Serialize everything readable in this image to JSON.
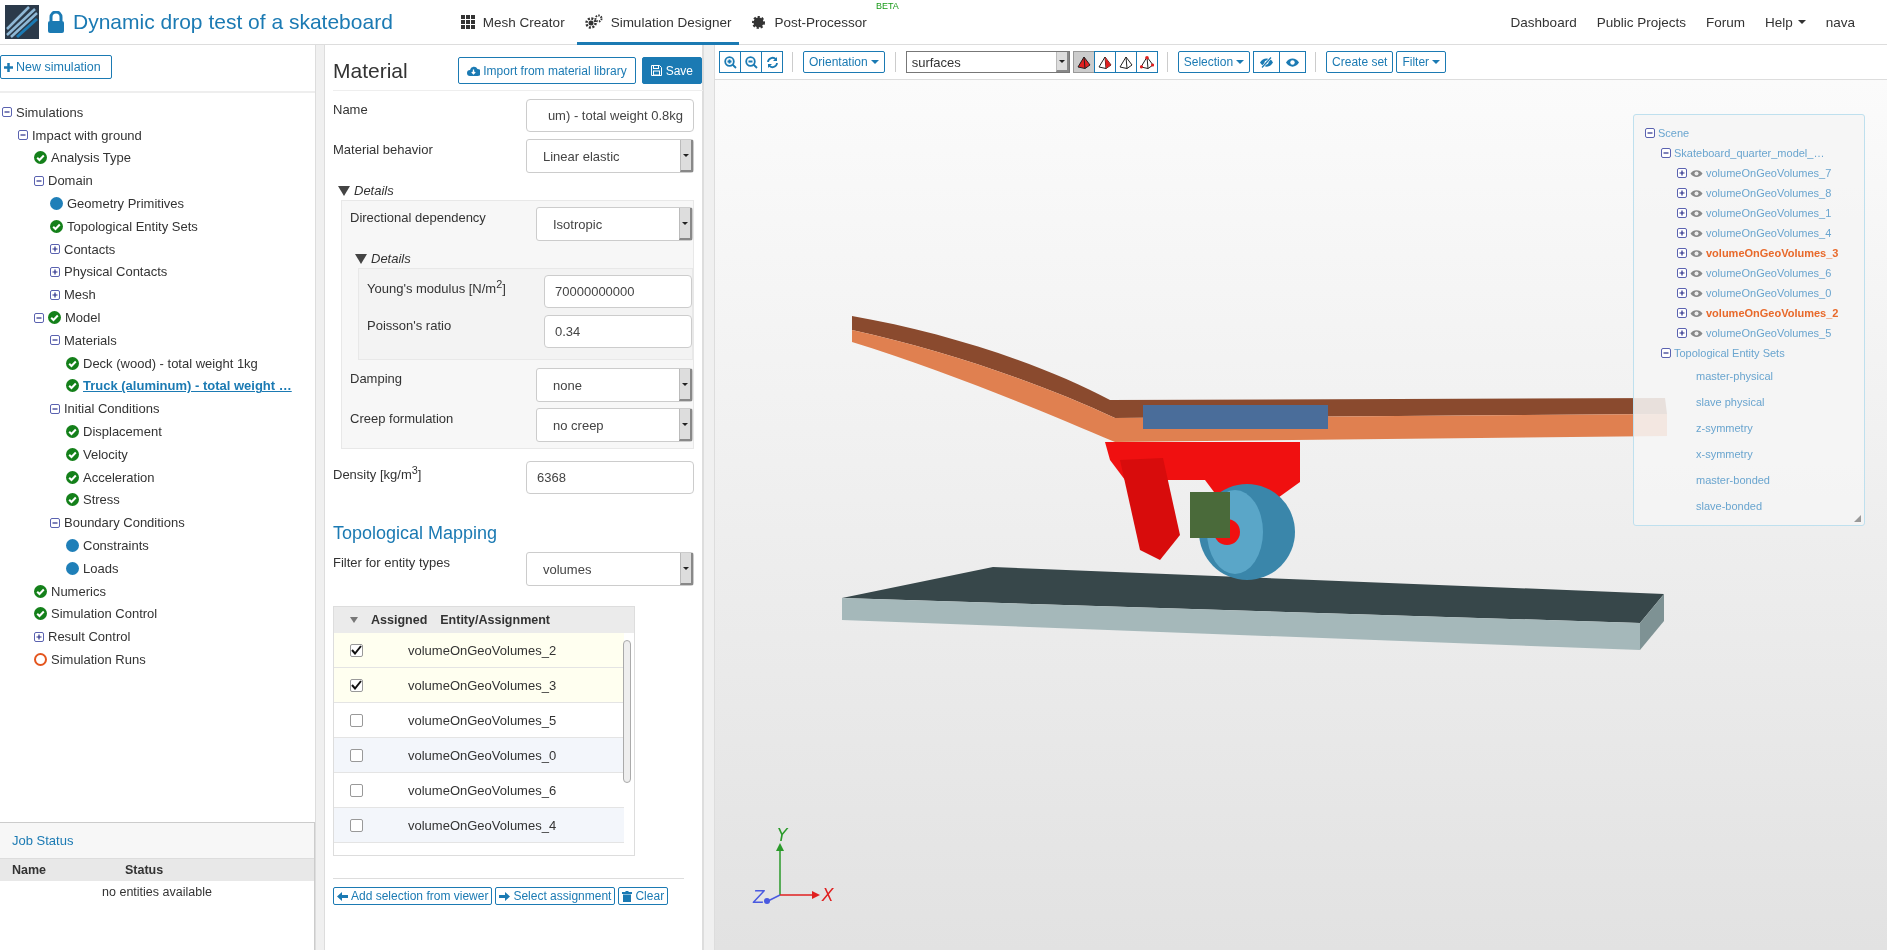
{
  "header": {
    "title": "Dynamic drop test of a skateboard",
    "tabs": [
      {
        "label": "Mesh Creator",
        "kind": "grid",
        "selected": false
      },
      {
        "label": "Simulation Designer",
        "kind": "gears",
        "selected": true
      },
      {
        "label": "Post-Processor",
        "kind": "cog",
        "selected": false,
        "badge": "BETA"
      }
    ],
    "links": [
      {
        "label": "Dashboard",
        "dropdown": false
      },
      {
        "label": "Public Projects",
        "dropdown": false
      },
      {
        "label": "Forum",
        "dropdown": false
      },
      {
        "label": "Help",
        "dropdown": true
      },
      {
        "label": "nava",
        "dropdown": false
      }
    ]
  },
  "sidebar": {
    "new_button": "New simulation",
    "tree": [
      {
        "label": "Simulations",
        "expanded": true,
        "selected": false,
        "children": [
          {
            "label": "Impact with ground",
            "expanded": true,
            "selected": false,
            "children": [
              {
                "label": "Analysis Type",
                "kind": "done",
                "selected": false
              },
              {
                "label": "Domain",
                "expanded": true,
                "selected": false,
                "children": [
                  {
                    "label": "Geometry Primitives",
                    "kind": "pending",
                    "selected": false
                  },
                  {
                    "label": "Topological Entity Sets",
                    "kind": "done",
                    "selected": false
                  },
                  {
                    "label": "Contacts",
                    "expanded": false,
                    "selected": false
                  },
                  {
                    "label": "Physical Contacts",
                    "expanded": false,
                    "selected": false
                  },
                  {
                    "label": "Mesh",
                    "expanded": false,
                    "selected": false
                  }
                ]
              },
              {
                "label": "Model",
                "expanded": true,
                "kind": "done",
                "selected": false,
                "children": [
                  {
                    "label": "Materials",
                    "expanded": true,
                    "selected": false,
                    "children": [
                      {
                        "label": "Deck (wood) - total weight 1kg",
                        "kind": "done",
                        "selected": false
                      },
                      {
                        "label": " Truck (aluminum) - total weight …",
                        "kind": "done",
                        "selected": true
                      }
                    ]
                  },
                  {
                    "label": "Initial Conditions",
                    "expanded": true,
                    "selected": false,
                    "children": [
                      {
                        "label": "Displacement",
                        "kind": "done",
                        "selected": false
                      },
                      {
                        "label": "Velocity",
                        "kind": "done",
                        "selected": false
                      },
                      {
                        "label": "Acceleration",
                        "kind": "done",
                        "selected": false
                      },
                      {
                        "label": "Stress",
                        "kind": "done",
                        "selected": false
                      }
                    ]
                  },
                  {
                    "label": "Boundary Conditions",
                    "expanded": true,
                    "selected": false,
                    "children": [
                      {
                        "label": "Constraints",
                        "kind": "pending",
                        "selected": false
                      },
                      {
                        "label": "Loads",
                        "kind": "pending",
                        "selected": false
                      }
                    ]
                  }
                ]
              },
              {
                "label": "Numerics",
                "kind": "done",
                "selected": false
              },
              {
                "label": "Simulation Control",
                "kind": "done",
                "selected": false
              },
              {
                "label": "Result Control",
                "expanded": false,
                "selected": false
              },
              {
                "label": "Simulation Runs",
                "kind": "open",
                "selected": false
              }
            ]
          }
        ]
      }
    ],
    "job_status": {
      "title": "Job Status",
      "columns": [
        "Name",
        "Status"
      ],
      "empty": "no entities available"
    }
  },
  "material": {
    "title": "Material",
    "import_button": "Import from material library",
    "save_button": "Save",
    "name": {
      "label": "Name",
      "value": "um) - total weight 0.8kg"
    },
    "behavior": {
      "label": "Material behavior",
      "value": "Linear elastic"
    },
    "details": {
      "label": "Details",
      "expanded": true,
      "direction": {
        "label": "Directional dependency",
        "value": "Isotropic"
      },
      "inner": {
        "label": "Details",
        "expanded": true,
        "rows": [
          {
            "label": "Young's modulus [N/m$^{2}$]",
            "value": "70000000000"
          },
          {
            "label": "Poisson's ratio",
            "value": "0.34"
          }
        ]
      },
      "damping": {
        "label": "Damping",
        "value": "none"
      },
      "creep": {
        "label": "Creep formulation",
        "value": "no creep"
      }
    },
    "density": {
      "label": "Density [kg/m$^{3}$]",
      "value": "6368"
    }
  },
  "mapping": {
    "title": "Topological Mapping",
    "filter": {
      "label": "Filter for entity types",
      "value": "volumes"
    },
    "columns": [
      "Assigned",
      "Entity/Assignment"
    ],
    "rows": [
      {
        "checked": true,
        "entity": "volumeOnGeoVolumes_2"
      },
      {
        "checked": true,
        "entity": "volumeOnGeoVolumes_3"
      },
      {
        "checked": false,
        "entity": "volumeOnGeoVolumes_5"
      },
      {
        "checked": false,
        "entity": "volumeOnGeoVolumes_0"
      },
      {
        "checked": false,
        "entity": "volumeOnGeoVolumes_6"
      },
      {
        "checked": false,
        "entity": "volumeOnGeoVolumes_4"
      }
    ],
    "buttons": [
      {
        "label": "Add selection from viewer",
        "kind": "left"
      },
      {
        "label": "Select assignment",
        "kind": "right"
      },
      {
        "label": "Clear",
        "kind": "trash"
      }
    ]
  },
  "viewer": {
    "toolbar": {
      "orientation": "Orientation",
      "display": "surfaces",
      "render_modes": [
        {
          "selected": true
        },
        {
          "selected": false
        },
        {
          "selected": false
        },
        {
          "selected": false
        }
      ],
      "selection": "Selection",
      "create_set": "Create set",
      "filter": "Filter"
    },
    "scene": [
      {
        "label": "Scene",
        "expanded": true,
        "selected": false,
        "children": [
          {
            "label": "Skateboard_quarter_model_…",
            "expanded": true,
            "selected": false,
            "children": [
              {
                "label": "volumeOnGeoVolumes_7",
                "expanded": false,
                "visible": true,
                "selected": false
              },
              {
                "label": "volumeOnGeoVolumes_8",
                "expanded": false,
                "visible": true,
                "selected": false
              },
              {
                "label": "volumeOnGeoVolumes_1",
                "expanded": false,
                "visible": true,
                "selected": false
              },
              {
                "label": "volumeOnGeoVolumes_4",
                "expanded": false,
                "visible": true,
                "selected": false
              },
              {
                "label": "volumeOnGeoVolumes_3",
                "expanded": false,
                "visible": true,
                "selected": true
              },
              {
                "label": "volumeOnGeoVolumes_6",
                "expanded": false,
                "visible": true,
                "selected": false
              },
              {
                "label": "volumeOnGeoVolumes_0",
                "expanded": false,
                "visible": true,
                "selected": false
              },
              {
                "label": "volumeOnGeoVolumes_2",
                "expanded": false,
                "visible": true,
                "selected": true
              },
              {
                "label": "volumeOnGeoVolumes_5",
                "expanded": false,
                "visible": true,
                "selected": false
              }
            ]
          },
          {
            "label": "Topological Entity Sets",
            "expanded": true,
            "selected": false,
            "children": [
              {
                "label": "master-physical",
                "selected": false
              },
              {
                "label": "slave physical",
                "selected": false
              },
              {
                "label": "z-symmetry",
                "selected": false
              },
              {
                "label": "x-symmetry",
                "selected": false
              },
              {
                "label": "master-bonded",
                "selected": false
              },
              {
                "label": "slave-bonded",
                "selected": false
              }
            ]
          }
        ]
      }
    ],
    "axes": {
      "y": "Y",
      "z": "Z",
      "x": "X"
    }
  }
}
